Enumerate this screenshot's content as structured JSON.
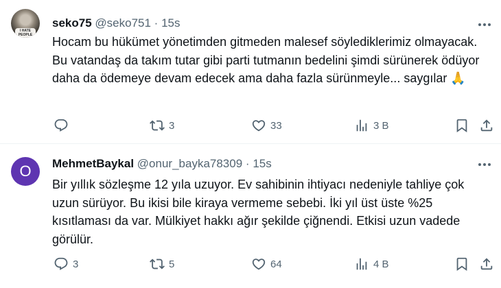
{
  "tweets": [
    {
      "author": {
        "name": "seko75",
        "handle": "@seko751",
        "time": "15s",
        "avatar_shirt_text": "I HATE PEOPLE"
      },
      "text": "Hocam bu hükümet yönetimden gitmeden malesef söylediklerimiz olmayacak. Bu vatandaş da takım tutar gibi parti tutmanın bedelini şimdi sürünerek ödüyor daha da ödemeye devam edecek ama daha fazla sürünmeyle... saygılar 🙏",
      "reply_count": "",
      "retweet_count": "3",
      "like_count": "33",
      "view_count": "3 B"
    },
    {
      "author": {
        "name": "MehmetBaykal",
        "handle": "@onur_bayka78309",
        "time": "15s",
        "avatar_letter": "O"
      },
      "text": "Bir yıllık sözleşme 12 yıla uzuyor. Ev sahibinin ihtiyacı nedeniyle tahliye çok uzun sürüyor. Bu ikisi bile kiraya vermeme sebebi. İki yıl üst üste %25 kısıtlaması da var. Mülkiyet hakkı ağır şekilde çiğnendi. Etkisi uzun vadede görülür.",
      "reply_count": "3",
      "retweet_count": "5",
      "like_count": "64",
      "view_count": "4 B"
    }
  ],
  "separator": "·",
  "colors": {
    "text": "#0f1419",
    "secondary": "#536471",
    "divider": "#eff3f4",
    "avatar_bg": "#5e35b1"
  }
}
